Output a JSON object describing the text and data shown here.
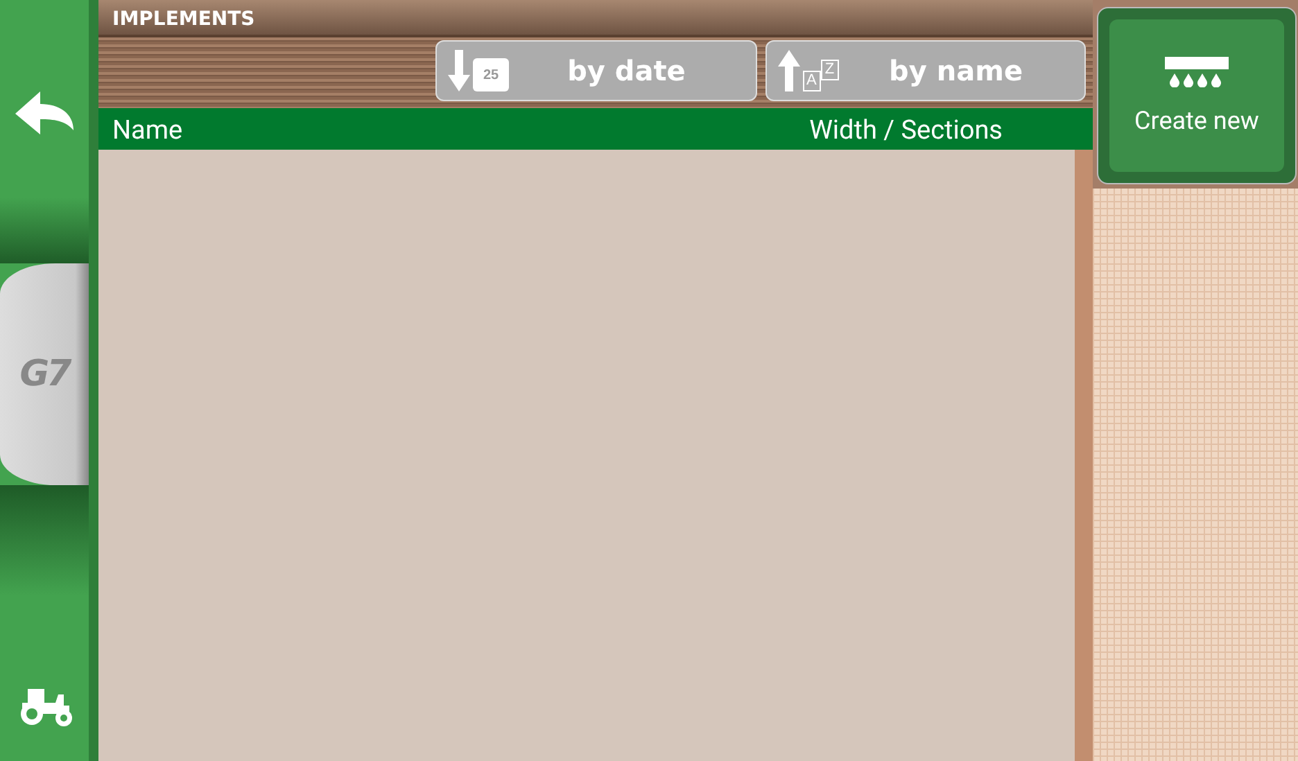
{
  "sidebar": {
    "logo": "G7"
  },
  "title": "IMPLEMENTS",
  "sort_buttons": [
    {
      "kind": "date",
      "label": "by date",
      "icon_text": "25"
    },
    {
      "kind": "name",
      "label": "by name",
      "icon_text": "AZ"
    }
  ],
  "table": {
    "columns": [
      "Name",
      "Width / Sections"
    ]
  },
  "create_button": {
    "label": "Create new"
  }
}
